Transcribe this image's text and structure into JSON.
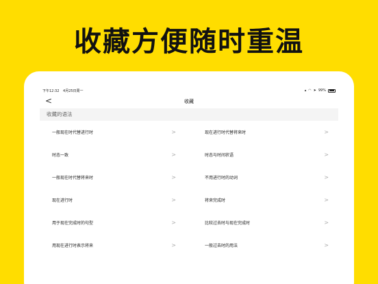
{
  "headline": "收藏方便随时重温",
  "status": {
    "time": "下午12:32",
    "date": "4月25日周一",
    "battery": "99%"
  },
  "nav": {
    "back": "<",
    "title": "收藏"
  },
  "section_title": "收藏的语法",
  "items": [
    {
      "left": "一般现在时代替进行时",
      "right": "现在进行时代替将来时"
    },
    {
      "left": "时态一致",
      "right": "时态与时间状语"
    },
    {
      "left": "一般现在时代替将来时",
      "right": "不用进行时的动词"
    },
    {
      "left": "现在进行时",
      "right": "将来完成时"
    },
    {
      "left": "用于现在完成时的句型",
      "right": "比较过去时与现在完成时"
    },
    {
      "left": "用现在进行时表示将来",
      "right": "一般过去时的用法"
    }
  ],
  "chevron": ">"
}
